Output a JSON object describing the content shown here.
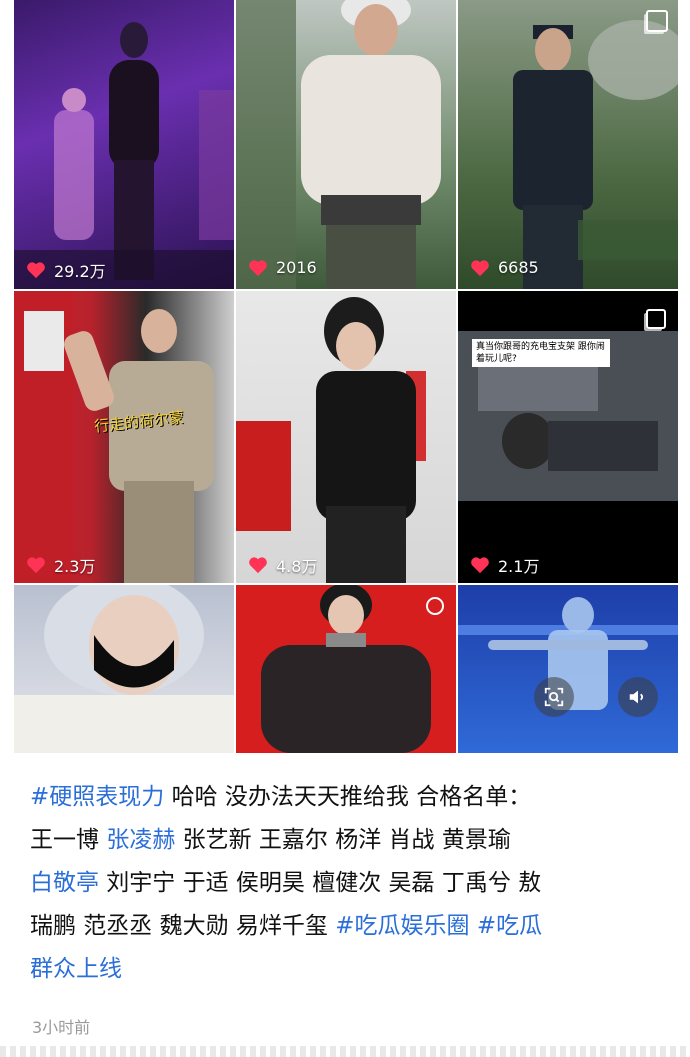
{
  "grid": {
    "tiles": [
      {
        "likes": "29.2万"
      },
      {
        "likes": "2016"
      },
      {
        "likes": "6685"
      },
      {
        "likes": "2.3万",
        "caption": "行走的荷尔蒙"
      },
      {
        "likes": "4.8万"
      },
      {
        "likes": "2.1万",
        "caption": "真当你跟哥的充电宝支架 跟你闹着玩儿呢?"
      },
      {},
      {},
      {}
    ]
  },
  "post": {
    "hashtag_1": "#硬照表现力",
    "text_1": " 哈哈 没办法天天推给我 合格名单：",
    "text_2": "王一博 ",
    "mention_1": "张凌赫",
    "text_3": " 张艺新 王嘉尔 杨洋 肖战 黄景瑜",
    "mention_2": "白敬亭",
    "text_4": " 刘宇宁 于适 侯明昊 檀健次 吴磊 丁禹兮 敖",
    "text_5": "瑞鹏 范丞丞 魏大勋 易烊千玺 ",
    "hashtag_2": "#吃瓜娱乐圈",
    "text_6": " ",
    "hashtag_3": "#吃瓜",
    "hashtag_3b": "群众上线",
    "timestamp": "3小时前"
  },
  "colors": {
    "link": "#2b6ed8",
    "like_heart": "#ff3355"
  },
  "icons": [
    "heart-icon",
    "multi-image-icon",
    "lens-search-icon",
    "volume-icon"
  ]
}
